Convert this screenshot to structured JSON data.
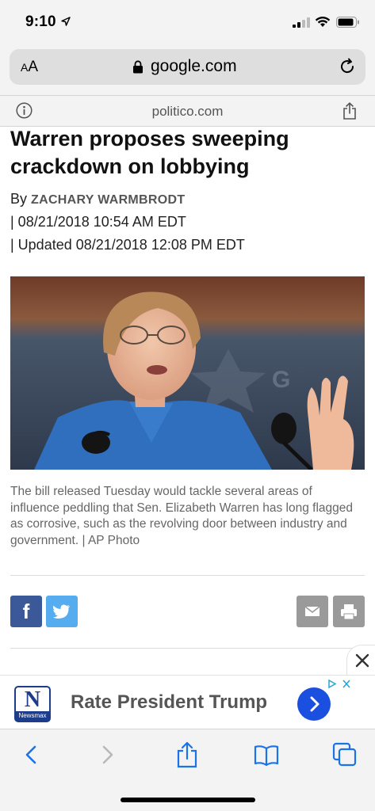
{
  "status_bar": {
    "time": "9:10"
  },
  "browser": {
    "text_size_label_small": "A",
    "text_size_label_large": "A",
    "url": "google.com",
    "site_domain": "politico.com"
  },
  "article": {
    "headline": "Warren proposes sweeping crackdown on lobbying",
    "by_label": "By ",
    "author": "ZACHARY WARMBRODT",
    "published": "| 08/21/2018 10:54 AM EDT",
    "updated": "| Updated 08/21/2018 12:08 PM EDT",
    "caption": "The bill released Tuesday would tackle several areas of influence peddling that Sen. Elizabeth Warren has long flagged as corrosive, such as the revolving door between industry and government. | AP Photo"
  },
  "share": {
    "facebook_icon": "facebook-icon",
    "twitter_icon": "twitter-icon",
    "email_icon": "mail-icon",
    "print_icon": "print-icon"
  },
  "ad": {
    "brand_letter": "N",
    "brand_name": "Newsmax",
    "text": "Rate President Trump",
    "accent_color": "#1a4fe0"
  },
  "toolbar": {
    "icons": [
      "back-icon",
      "forward-icon",
      "share-icon",
      "bookmarks-icon",
      "tabs-icon"
    ],
    "accent_color": "#1a73e8"
  }
}
